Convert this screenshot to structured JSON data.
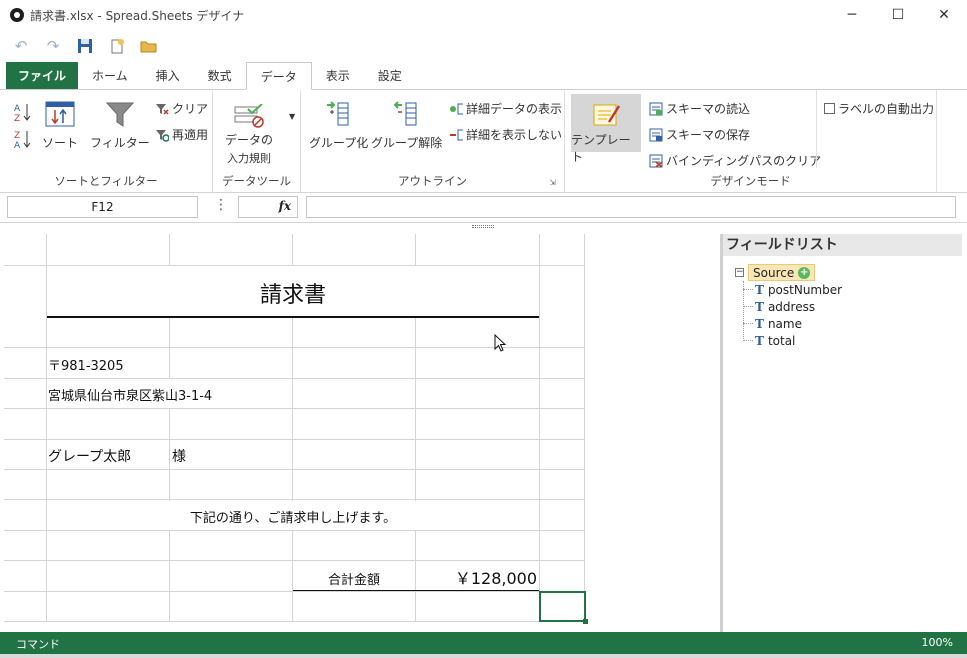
{
  "window": {
    "title": "請求書.xlsx - Spread.Sheets デザイナ",
    "minimize": "─",
    "maximize": "☐",
    "close": "✕"
  },
  "qat": {
    "undo": "↶",
    "redo": "↷",
    "save": "💾",
    "new": "📄",
    "open": "📂"
  },
  "tabs": [
    {
      "label": "ファイル"
    },
    {
      "label": "ホーム"
    },
    {
      "label": "挿入"
    },
    {
      "label": "数式"
    },
    {
      "label": "データ"
    },
    {
      "label": "表示"
    },
    {
      "label": "設定"
    }
  ],
  "ribbon": {
    "sort_filter": {
      "sort": "ソート",
      "filter": "フィルター",
      "clear": "クリア",
      "reapply": "再適用",
      "label": "ソートとフィルター"
    },
    "data_tools": {
      "validation_line1": "データの",
      "validation_line2": "入力規則",
      "label": "データツール"
    },
    "outline": {
      "group": "グループ化",
      "ungroup": "グループ解除",
      "show_detail": "詳細データの表示",
      "hide_detail": "詳細を表示しない",
      "label": "アウトライン"
    },
    "design_mode": {
      "template": "テンプレート",
      "load_schema": "スキーマの読込",
      "save_schema": "スキーマの保存",
      "clear_binding": "バインディングパスのクリア",
      "auto_label": "ラベルの自動出力",
      "label": "デザインモード"
    }
  },
  "formula_bar": {
    "cell_ref": "F12",
    "dots": "⋮",
    "fx": "fx",
    "formula": ""
  },
  "sheet": {
    "title": "請求書",
    "postal": "〒981-3205",
    "address": "宮城県仙台市泉区紫山3-1-4",
    "name": "グレープ太郎",
    "honorific": "様",
    "message": "下記の通り、ご請求申し上げます。",
    "total_label": "合計金額",
    "total_value": "￥128,000"
  },
  "field_list": {
    "header": "フィールドリスト",
    "expander": "−",
    "plus": "+",
    "source": "Source",
    "fields": [
      "postNumber",
      "address",
      "name",
      "total"
    ]
  },
  "status": {
    "mode": "コマンド",
    "zoom": "100%"
  }
}
